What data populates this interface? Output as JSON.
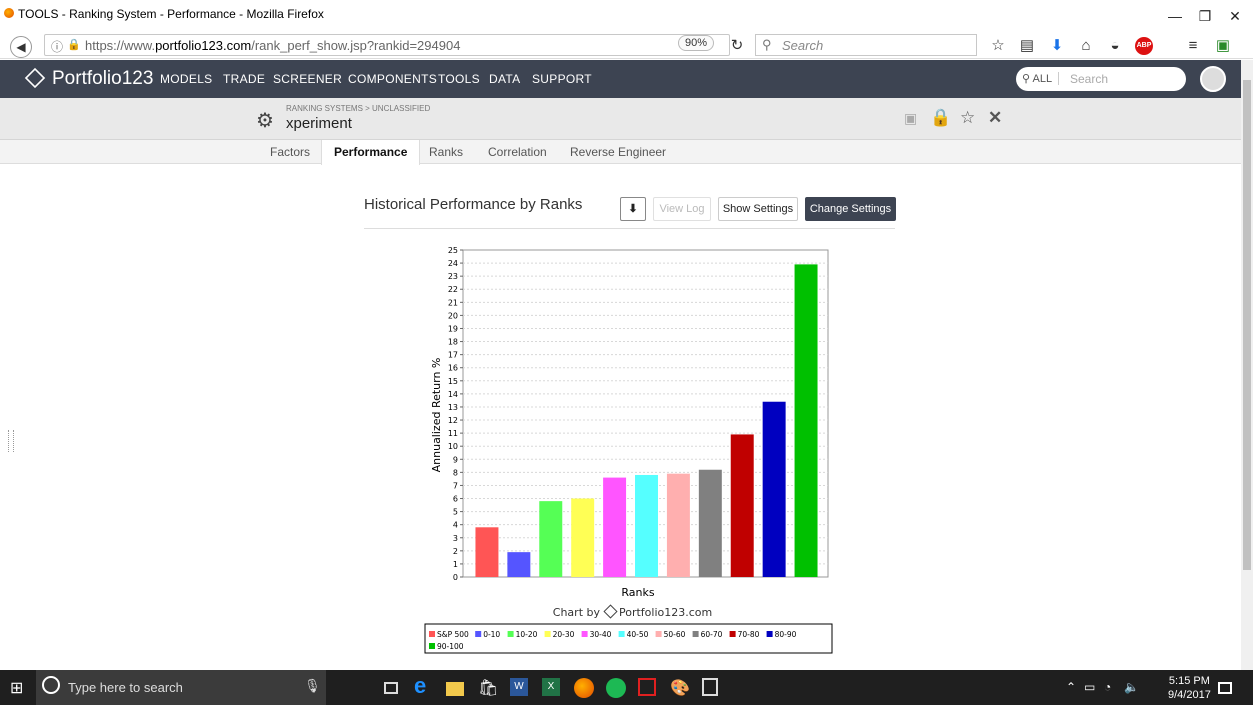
{
  "window": {
    "title": "TOOLS - Ranking System - Performance - Mozilla Firefox"
  },
  "browser": {
    "url_prefix": "https://www.",
    "url_domain": "portfolio123.com",
    "url_path": "/rank_perf_show.jsp?rankid=294904",
    "zoom": "90%",
    "search_placeholder": "Search"
  },
  "site": {
    "logo": "Portfolio123",
    "menu": [
      "MODELS",
      "TRADE",
      "SCREENER",
      "COMPONENTS",
      "TOOLS",
      "DATA",
      "SUPPORT"
    ],
    "search_scope": "ALL",
    "search_placeholder": "Search"
  },
  "ranking_system": {
    "breadcrumb": "RANKING SYSTEMS > UNCLASSIFIED",
    "name": "xperiment"
  },
  "tabs": [
    "Factors",
    "Performance",
    "Ranks",
    "Correlation",
    "Reverse Engineer"
  ],
  "active_tab": "Performance",
  "main": {
    "title": "Historical Performance by Ranks",
    "buttons": {
      "view_log": "View Log",
      "show_settings": "Show Settings",
      "change_settings": "Change Settings"
    }
  },
  "chart_data": {
    "type": "bar",
    "categories": [
      "S&P 500",
      "0-10",
      "10-20",
      "20-30",
      "30-40",
      "40-50",
      "50-60",
      "60-70",
      "70-80",
      "80-90",
      "90-100"
    ],
    "values": [
      3.8,
      1.9,
      5.8,
      6.0,
      7.6,
      7.8,
      7.9,
      8.2,
      10.9,
      13.4,
      23.9
    ],
    "colors": [
      "#ff5555",
      "#5555ff",
      "#55ff55",
      "#ffff55",
      "#ff55ff",
      "#55ffff",
      "#ffafaf",
      "#808080",
      "#c00000",
      "#0000c0",
      "#00c000"
    ],
    "xlabel": "Ranks",
    "ylabel": "Annualized Return %",
    "ylim": [
      0,
      25
    ],
    "yticks": [
      "0",
      "1",
      "2",
      "3",
      "4",
      "5",
      "6",
      "7",
      "8",
      "9",
      "10",
      "11",
      "12",
      "13",
      "14",
      "15",
      "16",
      "17",
      "18",
      "19",
      "20",
      "21",
      "22",
      "23",
      "24",
      "25"
    ],
    "credit": "Chart by",
    "credit_brand": "Portfolio123.com",
    "grid": true,
    "legend_position": "bottom"
  },
  "taskbar": {
    "search_placeholder": "Type here to search",
    "time": "5:15 PM",
    "date": "9/4/2017"
  }
}
